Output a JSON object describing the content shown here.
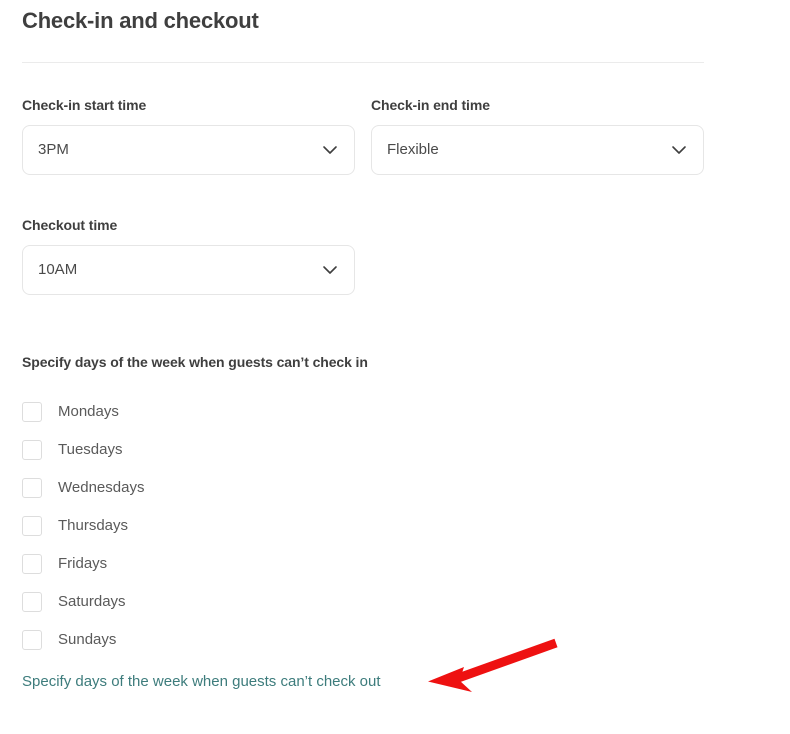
{
  "section": {
    "title": "Check-in and checkout"
  },
  "fields": [
    {
      "name": "checkin-start-time",
      "label": "Check-in start time",
      "value": "3PM",
      "icon": "chevron-down-icon"
    },
    {
      "name": "checkin-end-time",
      "label": "Check-in end time",
      "value": "Flexible",
      "icon": "chevron-down-icon"
    },
    {
      "name": "checkout-time",
      "label": "Checkout time",
      "value": "10AM",
      "icon": "chevron-down-icon"
    }
  ],
  "restricted_checkin": {
    "title": "Specify days of the week when guests can’t check in",
    "days": [
      {
        "label": "Mondays",
        "checked": false
      },
      {
        "label": "Tuesdays",
        "checked": false
      },
      {
        "label": "Wednesdays",
        "checked": false
      },
      {
        "label": "Thursdays",
        "checked": false
      },
      {
        "label": "Fridays",
        "checked": false
      },
      {
        "label": "Saturdays",
        "checked": false
      },
      {
        "label": "Sundays",
        "checked": false
      }
    ]
  },
  "checkout_link": {
    "label": "Specify days of the week when guests can’t check out"
  },
  "annotation": {
    "name": "red-arrow-annotation",
    "color": "#ee1111",
    "points_to": "checkout-days-link"
  },
  "colors": {
    "heading": "#3f3f3f",
    "label": "#3f3f3f",
    "value": "#4a4a4a",
    "checkbox_label": "#5a5a5a",
    "link": "#3d7c7c",
    "border": "#e6e6e6",
    "divider": "#ebebeb",
    "arrow": "#ee1111",
    "background": "#ffffff"
  }
}
